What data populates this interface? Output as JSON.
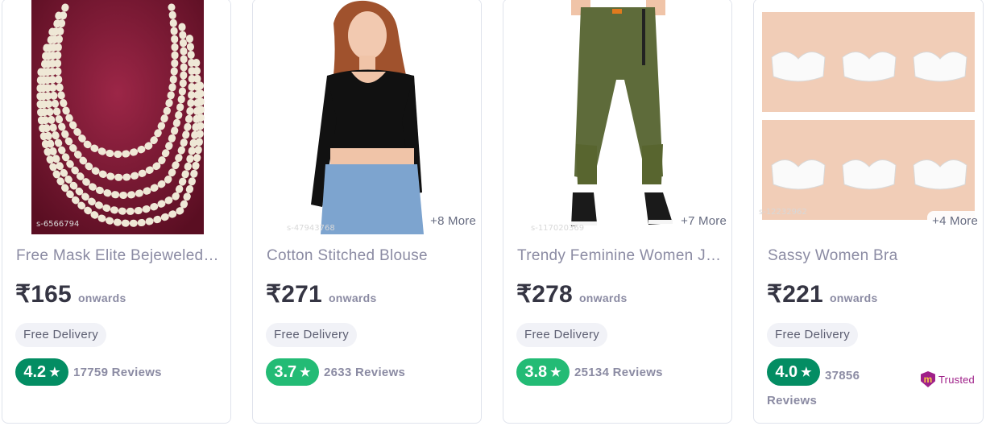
{
  "colors": {
    "rating_dark_green": "#038d63",
    "rating_green": "#23bb75",
    "trusted_purple": "#9f2089"
  },
  "products": [
    {
      "title": "Free Mask Elite Bejeweled Necklaces",
      "price": "₹165",
      "price_suffix": "onwards",
      "delivery": "Free Delivery",
      "rating": "4.2",
      "reviews": "17759 Reviews",
      "image_label": "s-6566794",
      "more": ""
    },
    {
      "title": "Cotton Stitched Blouse",
      "price": "₹271",
      "price_suffix": "onwards",
      "delivery": "Free Delivery",
      "rating": "3.7",
      "reviews": "2633 Reviews",
      "image_label": "s-47943768",
      "more": "+8 More"
    },
    {
      "title": "Trendy Feminine Women Jeans",
      "price": "₹278",
      "price_suffix": "onwards",
      "delivery": "Free Delivery",
      "rating": "3.8",
      "reviews": "25134 Reviews",
      "image_label": "s-117020369",
      "more": "+7 More"
    },
    {
      "title": "Sassy Women Bra",
      "price": "₹221",
      "price_suffix": "onwards",
      "delivery": "Free Delivery",
      "rating": "4.0",
      "reviews": "37856 Reviews",
      "image_label": "s-12232962",
      "more": "+4 More",
      "badge": "Trusted"
    }
  ]
}
